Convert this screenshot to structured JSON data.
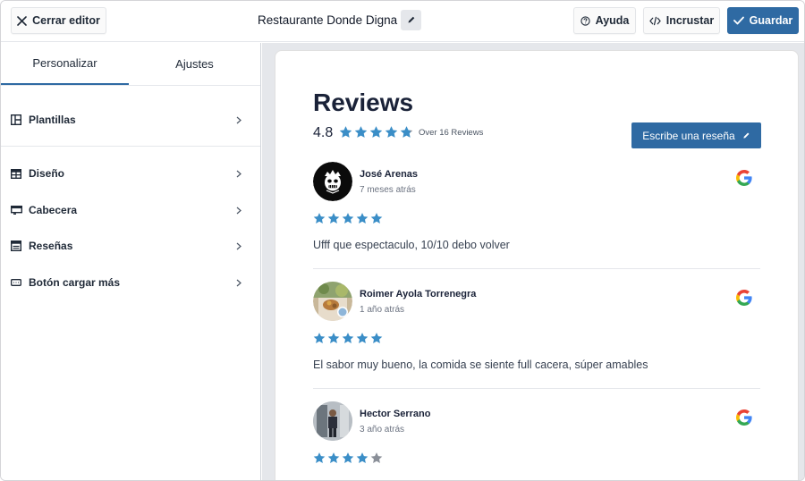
{
  "topbar": {
    "close_label": "Cerrar editor",
    "title": "Restaurante Donde Digna",
    "help_label": "Ayuda",
    "embed_label": "Incrustar",
    "save_label": "Guardar"
  },
  "sidebar": {
    "tabs": [
      {
        "label": "Personalizar",
        "active": true
      },
      {
        "label": "Ajustes",
        "active": false
      }
    ],
    "items": [
      {
        "label": "Plantillas",
        "icon": "layout-icon"
      },
      {
        "label": "Diseño",
        "icon": "table-icon"
      },
      {
        "label": "Cabecera",
        "icon": "header-icon"
      },
      {
        "label": "Reseñas",
        "icon": "reviews-icon"
      },
      {
        "label": "Botón cargar más",
        "icon": "button-icon"
      }
    ]
  },
  "widget": {
    "title": "Reviews",
    "rating": "4.8",
    "rating_value": 4.8,
    "count_text": "Over 16 Reviews",
    "write_label": "Escribe una reseña",
    "reviews": [
      {
        "name": "José Arenas",
        "time": "7 meses atrás",
        "stars": 5,
        "text": "Ufff que espectaculo, 10/10 debo volver",
        "source": "google-icon"
      },
      {
        "name": "Roimer Ayola Torrenegra",
        "time": "1 año atrás",
        "stars": 5,
        "text": "El sabor muy bueno, la comida se siente full cacera, súper amables",
        "source": "google-icon"
      },
      {
        "name": "Hector Serrano",
        "time": "3 año atrás",
        "stars": 4,
        "text": "",
        "source": "google-icon"
      }
    ]
  },
  "colors": {
    "accent": "#2f6aa3",
    "star": "#3b8ec7",
    "star_empty": "#8a8f98",
    "text_dark": "#1a2238"
  }
}
